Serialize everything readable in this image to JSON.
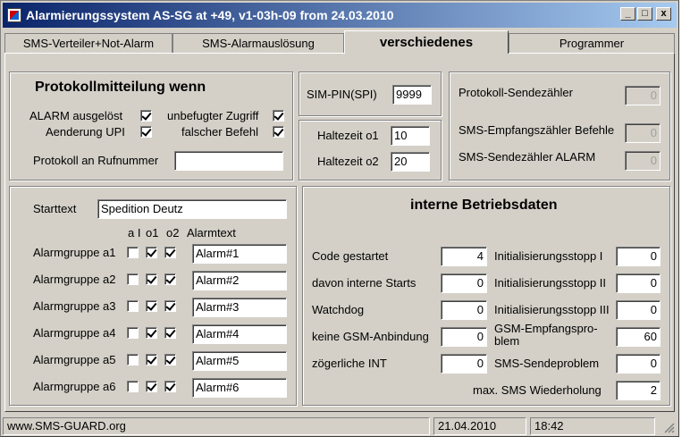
{
  "window": {
    "title": "Alarmierungssystem AS-SG at +49, v1-03h-09 from 24.03.2010",
    "min": "_",
    "max": "□",
    "close": "x"
  },
  "tabs": [
    "SMS-Verteiler+Not-Alarm",
    "SMS-Alarmauslösung",
    "verschiedenes",
    "Programmer"
  ],
  "protokoll": {
    "heading": "Protokollmitteilung wenn",
    "alarm_label": "ALARM ausgelöst",
    "alarm_checked": true,
    "zugriff_label": "unbefugter Zugriff",
    "zugriff_checked": true,
    "upi_label": "Aenderung UPI",
    "upi_checked": true,
    "befehl_label": "falscher Befehl",
    "befehl_checked": true,
    "rufnummer_label": "Protokoll an Rufnummer",
    "rufnummer_value": ""
  },
  "sim": {
    "label": "SIM-PIN(SPI)",
    "value": "9999"
  },
  "halte": {
    "o1_label": "Haltezeit o1",
    "o1_value": "10",
    "o2_label": "Haltezeit o2",
    "o2_value": "20"
  },
  "zaehler": {
    "sende_label": "Protokoll-Sendezähler",
    "sende_value": "0",
    "empfang_label": "SMS-Empfangszähler Befehle",
    "empfang_value": "0",
    "alarm_label": "SMS-Sendezähler ALARM",
    "alarm_value": "0"
  },
  "alarm": {
    "starttext_label": "Starttext",
    "starttext_value": "Spedition Deutz",
    "hdr_a": "a I",
    "hdr_o1": "o1",
    "hdr_o2": "o2",
    "hdr_text": "Alarmtext",
    "rows": [
      {
        "label": "Alarmgruppe a1",
        "a": false,
        "o1": true,
        "o2": true,
        "text": "Alarm#1"
      },
      {
        "label": "Alarmgruppe a2",
        "a": false,
        "o1": true,
        "o2": true,
        "text": "Alarm#2"
      },
      {
        "label": "Alarmgruppe a3",
        "a": false,
        "o1": true,
        "o2": true,
        "text": "Alarm#3"
      },
      {
        "label": "Alarmgruppe a4",
        "a": false,
        "o1": true,
        "o2": true,
        "text": "Alarm#4"
      },
      {
        "label": "Alarmgruppe a5",
        "a": false,
        "o1": true,
        "o2": true,
        "text": "Alarm#5"
      },
      {
        "label": "Alarmgruppe a6",
        "a": false,
        "o1": true,
        "o2": true,
        "text": "Alarm#6"
      }
    ]
  },
  "betrieb": {
    "heading": "interne Betriebsdaten",
    "code_label": "Code gestartet",
    "code_value": "4",
    "starts_label": "davon interne Starts",
    "starts_value": "0",
    "watchdog_label": "Watchdog",
    "watchdog_value": "0",
    "gsm_label": "keine GSM-Anbindung",
    "gsm_value": "0",
    "int_label": "zögerliche INT",
    "int_value": "0",
    "init1_label": "Initialisierungsstopp I",
    "init1_value": "0",
    "init2_label": "Initialisierungsstopp II",
    "init2_value": "0",
    "init3_label": "Initialisierungsstopp III",
    "init3_value": "0",
    "gsmemp_label1": "GSM-Empfangspro-",
    "gsmemp_label2": "blem",
    "gsmemp_value": "60",
    "sende_label": "SMS-Sendeproblem",
    "sende_value": "0",
    "wdh_label": "max. SMS Wiederholung",
    "wdh_value": "2"
  },
  "status": {
    "url": "www.SMS-GUARD.org",
    "date": "21.04.2010",
    "time": "18:42"
  }
}
